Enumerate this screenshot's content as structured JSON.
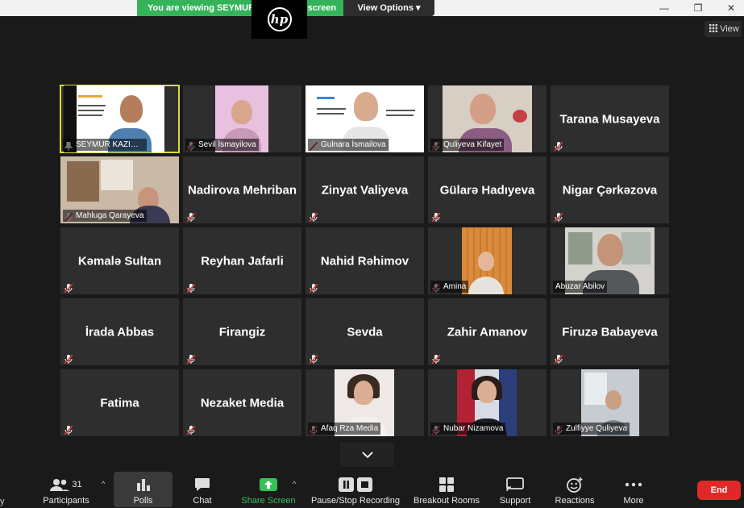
{
  "banner": {
    "viewing_text": "You are viewing SEYMUR KAZIMOV's screen",
    "view_options": "View Options ▾"
  },
  "window": {
    "minimize": "—",
    "restore": "❐",
    "close": "✕"
  },
  "view_button": "View",
  "participants": [
    {
      "label": "SEYMUR KAZIMOV",
      "video": true,
      "active": true,
      "pinned": true,
      "muted": false
    },
    {
      "label": "Sevil İsmayilova",
      "video": true,
      "muted": true
    },
    {
      "label": "Gulnara İsmailova",
      "video": true,
      "muted": true
    },
    {
      "label": "Quliyeva Kifayet",
      "video": true,
      "muted": true
    },
    {
      "name": "Tarana Musayeva",
      "video": false,
      "muted": true
    },
    {
      "label": "Mahluga Qarayeva",
      "video": true,
      "muted": true
    },
    {
      "name": "Nadirova Mehriban",
      "video": false,
      "muted": true
    },
    {
      "name": "Zinyat Valiyeva",
      "video": false,
      "muted": true
    },
    {
      "name": "Gülarə Hadıyeva",
      "video": false,
      "muted": true
    },
    {
      "name": "Nigar Çərkəzova",
      "video": false,
      "muted": true
    },
    {
      "name": "Kəmalə Sultan",
      "video": false,
      "muted": true
    },
    {
      "name": "Reyhan Jafarli",
      "video": false,
      "muted": true
    },
    {
      "name": "Nahid Rəhimov",
      "video": false,
      "muted": true
    },
    {
      "label": "Amina",
      "video": true,
      "muted": true
    },
    {
      "label": "Abuzar Abilov",
      "video": true,
      "muted": false
    },
    {
      "name": "İrada Abbas",
      "video": false,
      "muted": true
    },
    {
      "name": "Firangiz",
      "video": false,
      "muted": true
    },
    {
      "name": "Sevda",
      "video": false,
      "muted": true
    },
    {
      "name": "Zahir Amanov",
      "video": false,
      "muted": true
    },
    {
      "name": "Firuzə Babayeva",
      "video": false,
      "muted": true
    },
    {
      "name": "Fatima",
      "video": false,
      "muted": true
    },
    {
      "name": "Nezaket Media",
      "video": false,
      "muted": true
    },
    {
      "label": "Afaq Rza Media",
      "video": true,
      "muted": true
    },
    {
      "label": "Nubar Nizamova",
      "video": true,
      "muted": true
    },
    {
      "label": "Zulfiyye Quliyeva",
      "video": true,
      "muted": true
    }
  ],
  "toolbar": {
    "participants_label": "Participants",
    "participants_count": "31",
    "polls_label": "Polls",
    "chat_label": "Chat",
    "share_label": "Share Screen",
    "recording_label": "Pause/Stop Recording",
    "breakout_label": "Breakout Rooms",
    "support_label": "Support",
    "reactions_label": "Reactions",
    "more_label": "More",
    "end_label": "End",
    "left_edge_label": "y"
  },
  "colors": {
    "share_green": "#35c05a",
    "banner_green": "#35b35a",
    "end_red": "#e02828",
    "mute_red": "#e0393e",
    "active_border": "#d7dd3a"
  }
}
